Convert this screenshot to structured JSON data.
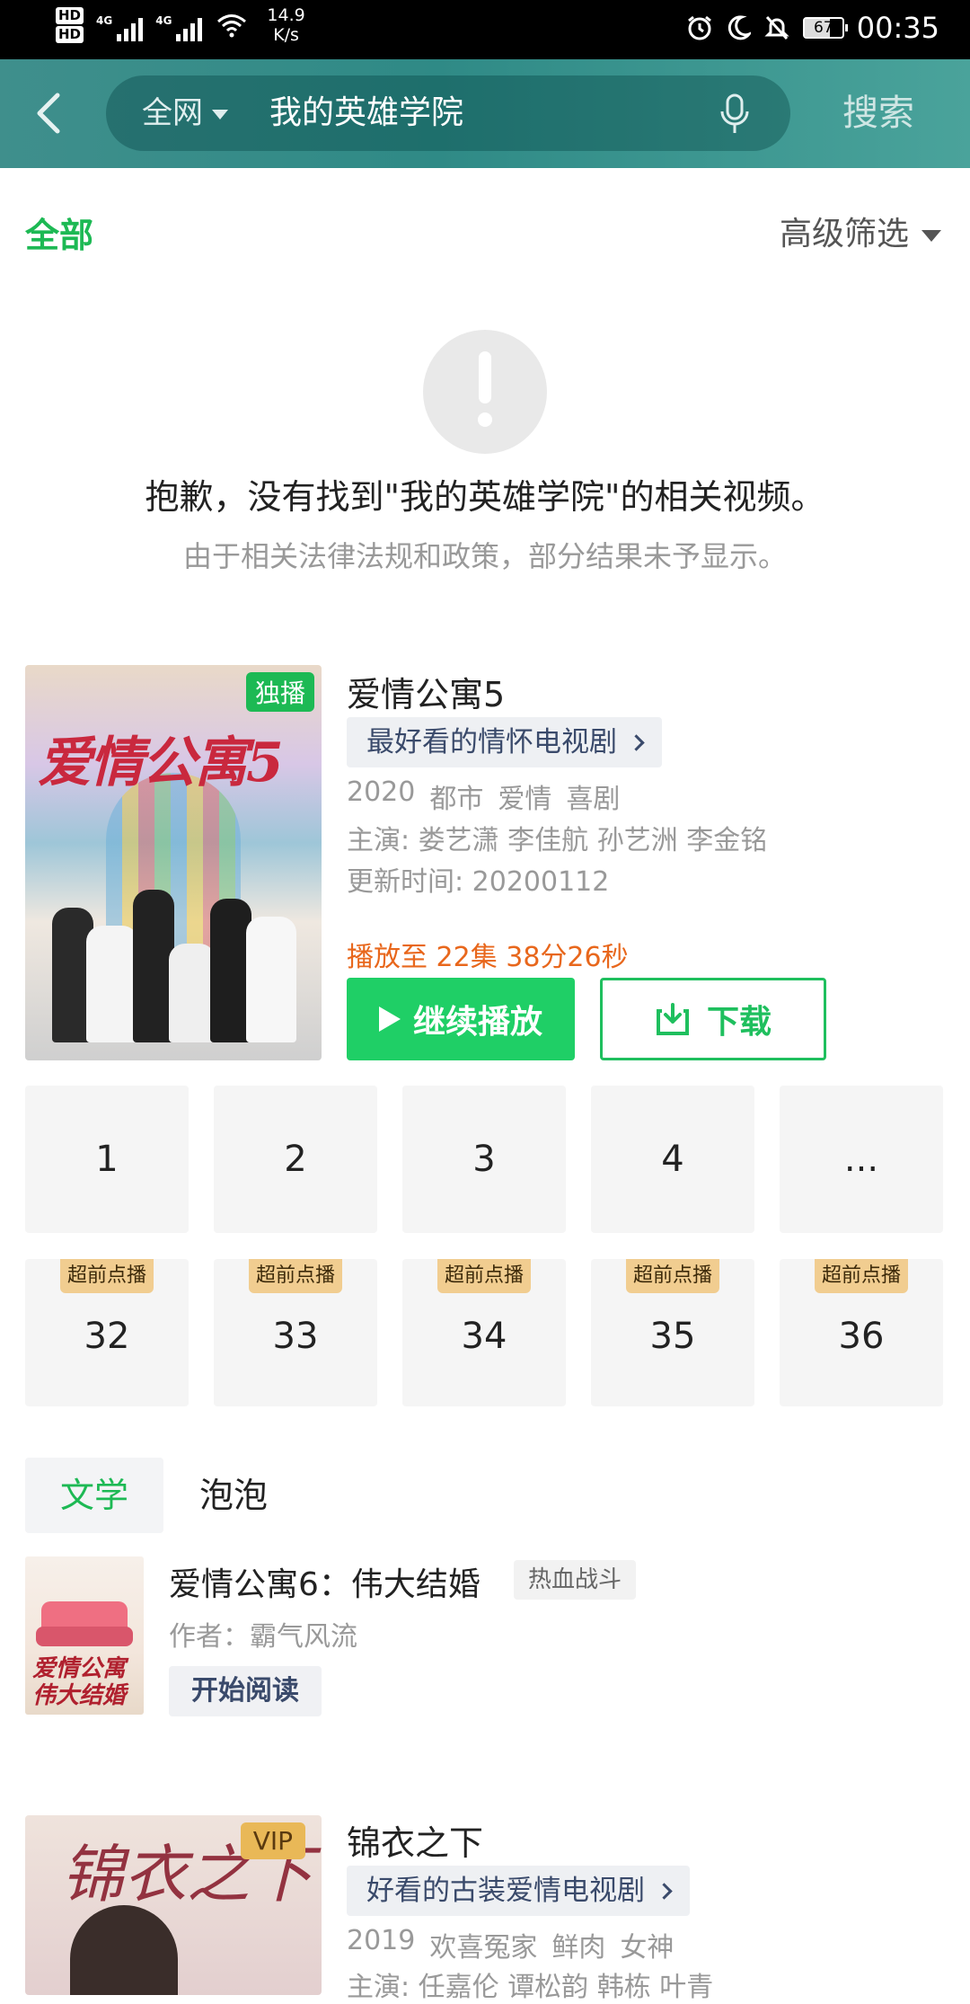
{
  "status_bar": {
    "hd1": "HD",
    "hd2": "HD",
    "net1": "4G",
    "net2": "4G",
    "speed_value": "14.9",
    "speed_unit": "K/s",
    "battery": "67",
    "time": "00:35"
  },
  "search": {
    "scope": "全网",
    "query": "我的英雄学院",
    "button_label": "搜索"
  },
  "filter": {
    "active_tab": "全部",
    "advanced_label": "高级筛选"
  },
  "empty_state": {
    "title": "抱歉，没有找到\"我的英雄学院\"的相关视频。",
    "subtitle": "由于相关法律法规和政策，部分结果未予显示。"
  },
  "show1": {
    "poster_title": "爱情公寓5",
    "badge": "独播",
    "title": "爱情公寓5",
    "promo": "最好看的情怀电视剧",
    "tags": [
      "2020",
      "都市",
      "爱情",
      "喜剧"
    ],
    "cast": "主演: 娄艺潇  李佳航  孙艺洲  李金铭",
    "updated": "更新时间: 20200112",
    "progress": "播放至 22集 38分26秒",
    "play_label": "继续播放",
    "download_label": "下载",
    "episodes": [
      "1",
      "2",
      "3",
      "4",
      "..."
    ],
    "episodes_preview": [
      "32",
      "33",
      "34",
      "35",
      "36"
    ],
    "preview_tag": "超前点播"
  },
  "categories": {
    "active": "文学",
    "other": "泡泡"
  },
  "book": {
    "cover_text": "爱情公寓 伟大结婚",
    "title": "爱情公寓6：伟大结婚",
    "genre": "热血战斗",
    "author": "作者：霸气风流",
    "read_label": "开始阅读"
  },
  "show2": {
    "poster_title": "锦衣之下",
    "badge": "VIP",
    "title": "锦衣之下",
    "promo": "好看的古装爱情电视剧",
    "tags": [
      "2019",
      "欢喜冤家",
      "鲜肉",
      "女神"
    ],
    "cast": "主演: 任嘉伦  谭松韵  韩栋  叶青"
  },
  "colors": {
    "accent_green": "#1db954",
    "header_teal": "#3f8f8c",
    "progress_orange": "#e8671c",
    "preview_gold": "#f1cd90"
  }
}
